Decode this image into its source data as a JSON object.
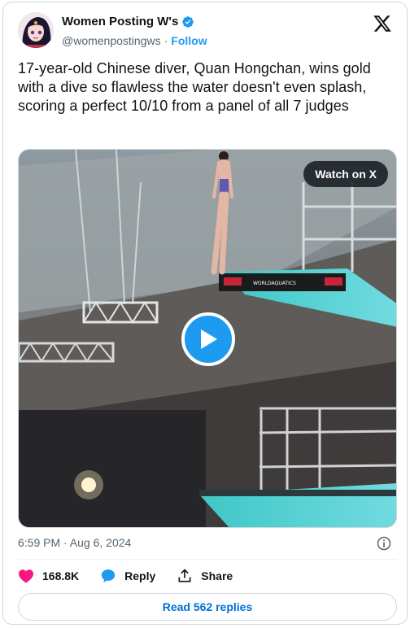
{
  "author": {
    "display_name": "Women Posting W's",
    "handle": "@womenpostingws",
    "separator": "·",
    "follow_label": "Follow",
    "verified": true
  },
  "tweet": {
    "text": "17-year-old Chinese diver, Quan Hongchan, wins gold with a dive so flawless the water doesn't even splash, scoring a perfect 10/10 from a panel of all 7 judges"
  },
  "media": {
    "watch_label": "Watch on X",
    "board_banner": "WORLDAQUATICS",
    "accent_color": "#1d9bf0"
  },
  "meta": {
    "timestamp": "6:59 PM · Aug 6, 2024"
  },
  "actions": {
    "like_count": "168.8K",
    "reply_label": "Reply",
    "share_label": "Share"
  },
  "footer": {
    "read_replies_label": "Read 562 replies"
  },
  "colors": {
    "like": "#f91880",
    "brand": "#1d9bf0",
    "secondary_text": "#536471"
  }
}
